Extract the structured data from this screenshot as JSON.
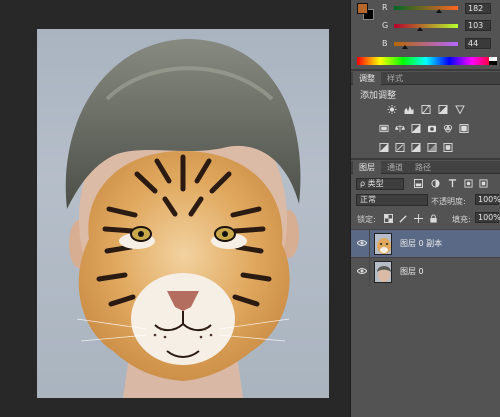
{
  "colors": {
    "foreground": "#b6672c",
    "background": "#000000",
    "selection": "#5a6a86"
  },
  "color_panel": {
    "channels": [
      {
        "label": "R",
        "value": "182",
        "fraction": 0.71
      },
      {
        "label": "G",
        "value": "103",
        "fraction": 0.4
      },
      {
        "label": "B",
        "value": "44",
        "fraction": 0.17
      }
    ]
  },
  "adjust_tabs": {
    "tab1": "调整",
    "tab2": "样式"
  },
  "adjustments": {
    "title": "添加调整",
    "row1_icons": [
      "brightness-icon",
      "levels-icon",
      "curves-icon",
      "exposure-icon",
      "vibrance-icon"
    ],
    "row2_icons": [
      "hue-saturation-icon",
      "color-balance-icon",
      "black-white-icon",
      "photo-filter-icon",
      "channel-mixer-icon",
      "color-lookup-icon"
    ],
    "row3_icons": [
      "invert-icon",
      "posterize-icon",
      "threshold-icon",
      "gradient-map-icon",
      "selective-color-icon"
    ]
  },
  "layers_tabs": {
    "tab1": "图层",
    "tab2": "通道",
    "tab3": "路径"
  },
  "layers": {
    "filter_label": "ρ 类型",
    "blend_mode": "正常",
    "opacity_label": "不透明度:",
    "opacity_value": "100%",
    "lock_label": "锁定:",
    "fill_label": "填充:",
    "fill_value": "100%",
    "items": [
      {
        "name": "图层 0 副本",
        "selected": true
      },
      {
        "name": "图层 0",
        "selected": false
      }
    ]
  }
}
